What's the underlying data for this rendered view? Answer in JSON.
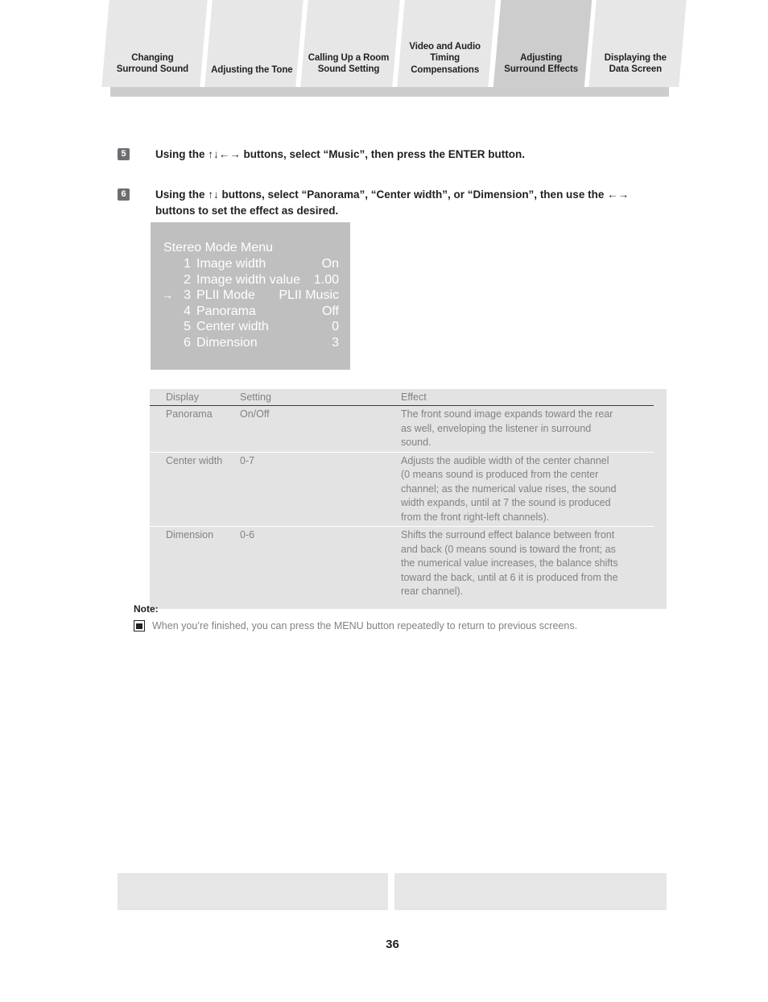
{
  "header": {
    "tabs": [
      {
        "label": "Changing\nSurround Sound",
        "active": false
      },
      {
        "label": "Adjusting the Tone",
        "active": false
      },
      {
        "label": "Calling Up a Room\nSound Setting",
        "active": false
      },
      {
        "label": "Video and Audio\nTiming\nCompensations",
        "active": false
      },
      {
        "label": "Adjusting\nSurround Effects",
        "active": true
      },
      {
        "label": "Displaying the\nData Screen",
        "active": false
      }
    ],
    "active_tab": "Adjusting Surround Effects",
    "inactive_tab_color": "#e7e7e7",
    "active_tab_color": "#cdcdcd",
    "underbar_color": "#cdcdcd"
  },
  "steps": [
    {
      "number": "5",
      "text": "Using the ↑↓←→ buttons, select “Music”, then press the ENTER button."
    },
    {
      "number": "6",
      "text": "Using the ↑↓ buttons, select “Panorama”, “Center width”, or “Dimension”, then use the ←→ buttons to set the effect as desired."
    }
  ],
  "osd": {
    "background_color": "#bfbfbf",
    "text_color": "#ffffff",
    "title": "Stereo Mode Menu",
    "rows": [
      {
        "marker": "",
        "number": "1",
        "name": "Image width",
        "value": "On"
      },
      {
        "marker": "",
        "number": "2",
        "name": "Image width value",
        "value": "1.00"
      },
      {
        "marker": "→",
        "number": "3",
        "name": "PLII Mode",
        "value": "PLII Music"
      },
      {
        "marker": "",
        "number": "4",
        "name": "Panorama",
        "value": "Off"
      },
      {
        "marker": "",
        "number": "5",
        "name": "Center width",
        "value": "0"
      },
      {
        "marker": "",
        "number": "6",
        "name": "Dimension",
        "value": "3"
      }
    ]
  },
  "spec_table": {
    "background_color": "#e3e3e3",
    "columns": [
      "Display",
      "Setting",
      "Effect"
    ],
    "rows": [
      {
        "display": "Panorama",
        "setting": "On/Off",
        "effect": [
          "The front sound image expands toward the rear",
          "as well, enveloping the listener in surround",
          "sound."
        ]
      },
      {
        "display": "Center width",
        "setting": "0-7",
        "effect": [
          "Adjusts the audible width of the center channel",
          "(0 means sound is produced from the center",
          "channel; as the numerical value rises, the sound",
          "width expands, until at 7 the sound is produced",
          "from the front right-left channels)."
        ]
      },
      {
        "display": "Dimension",
        "setting": "0-6",
        "effect": [
          "Shifts the surround effect balance between front",
          "and back (0 means sound is toward the front; as",
          "the numerical value increases, the balance shifts",
          "toward the back, until at 6 it is produced from the",
          "rear channel)."
        ]
      }
    ]
  },
  "note": {
    "title": "Note:",
    "icon": "note-screen-icon",
    "text": "When you’re finished, you can press the MENU button repeatedly to return to previous screens."
  },
  "footer": {
    "box_color": "#e6e6e6",
    "page_number": "36"
  }
}
